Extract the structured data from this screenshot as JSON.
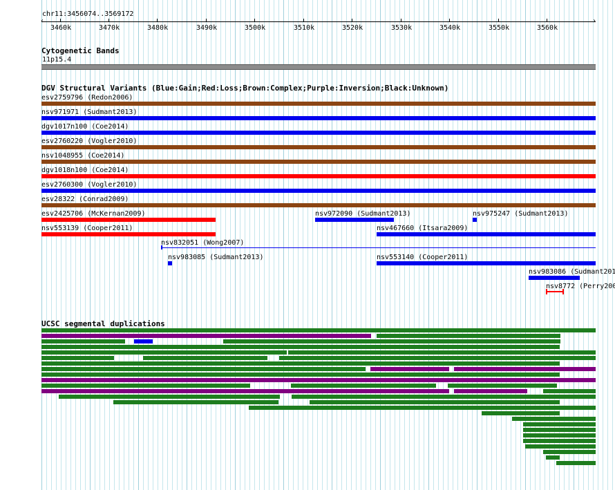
{
  "browser": {
    "position": "chr11:3456074..3569172",
    "ruler_ticks": [
      "3460k",
      "3470k",
      "3480k",
      "3490k",
      "3500k",
      "3510k",
      "3520k",
      "3530k",
      "3540k",
      "3550k",
      "3560k"
    ]
  },
  "tracks": {
    "cytogenetic": {
      "title": "Cytogenetic Bands",
      "band": "11p15.4",
      "color": "#8c8c8c"
    },
    "dgv": {
      "title": "DGV Structural Variants (Blue:Gain;Red:Loss;Brown:Complex;Purple:Inversion;Black:Unknown)",
      "colors": {
        "gain": "#0000ee",
        "loss": "#ff0000",
        "complex": "#8b4513",
        "inversion": "#800080",
        "unknown": "#000000"
      },
      "features": [
        {
          "label": "esv2759796 (Redon2006)",
          "type": "complex"
        },
        {
          "label": "nsv971971 (Sudmant2013)",
          "type": "gain"
        },
        {
          "label": "dgv1017n100 (Coe2014)",
          "type": "gain"
        },
        {
          "label": "esv2760220 (Vogler2010)",
          "type": "complex"
        },
        {
          "label": "nsv1048955 (Coe2014)",
          "type": "complex"
        },
        {
          "label": "dgv1018n100 (Coe2014)",
          "type": "loss"
        },
        {
          "label": "esv2760300 (Vogler2010)",
          "type": "gain"
        },
        {
          "label": "esv28322 (Conrad2009)",
          "type": "complex"
        },
        {
          "label": "esv2425706 (McKernan2009)",
          "type": "loss"
        },
        {
          "label": "nsv972090 (Sudmant2013)",
          "type": "gain"
        },
        {
          "label": "nsv975247 (Sudmant2013)",
          "type": "gain"
        },
        {
          "label": "nsv553139 (Cooper2011)",
          "type": "loss"
        },
        {
          "label": "nsv467660 (Itsara2009)",
          "type": "gain"
        },
        {
          "label": "nsv832051 (Wong2007)",
          "type": "gain"
        },
        {
          "label": "nsv983085 (Sudmant2013)",
          "type": "gain"
        },
        {
          "label": "nsv553140 (Cooper2011)",
          "type": "gain"
        },
        {
          "label": "nsv983086 (Sudmant201",
          "type": "gain"
        },
        {
          "label": "nsv8772 (Perry200",
          "type": "loss"
        }
      ]
    },
    "segdups": {
      "title": "UCSC segmental duplications",
      "colors": {
        "green": "#1e7d1e",
        "purple": "#800080",
        "blue": "#0000ee"
      }
    }
  }
}
